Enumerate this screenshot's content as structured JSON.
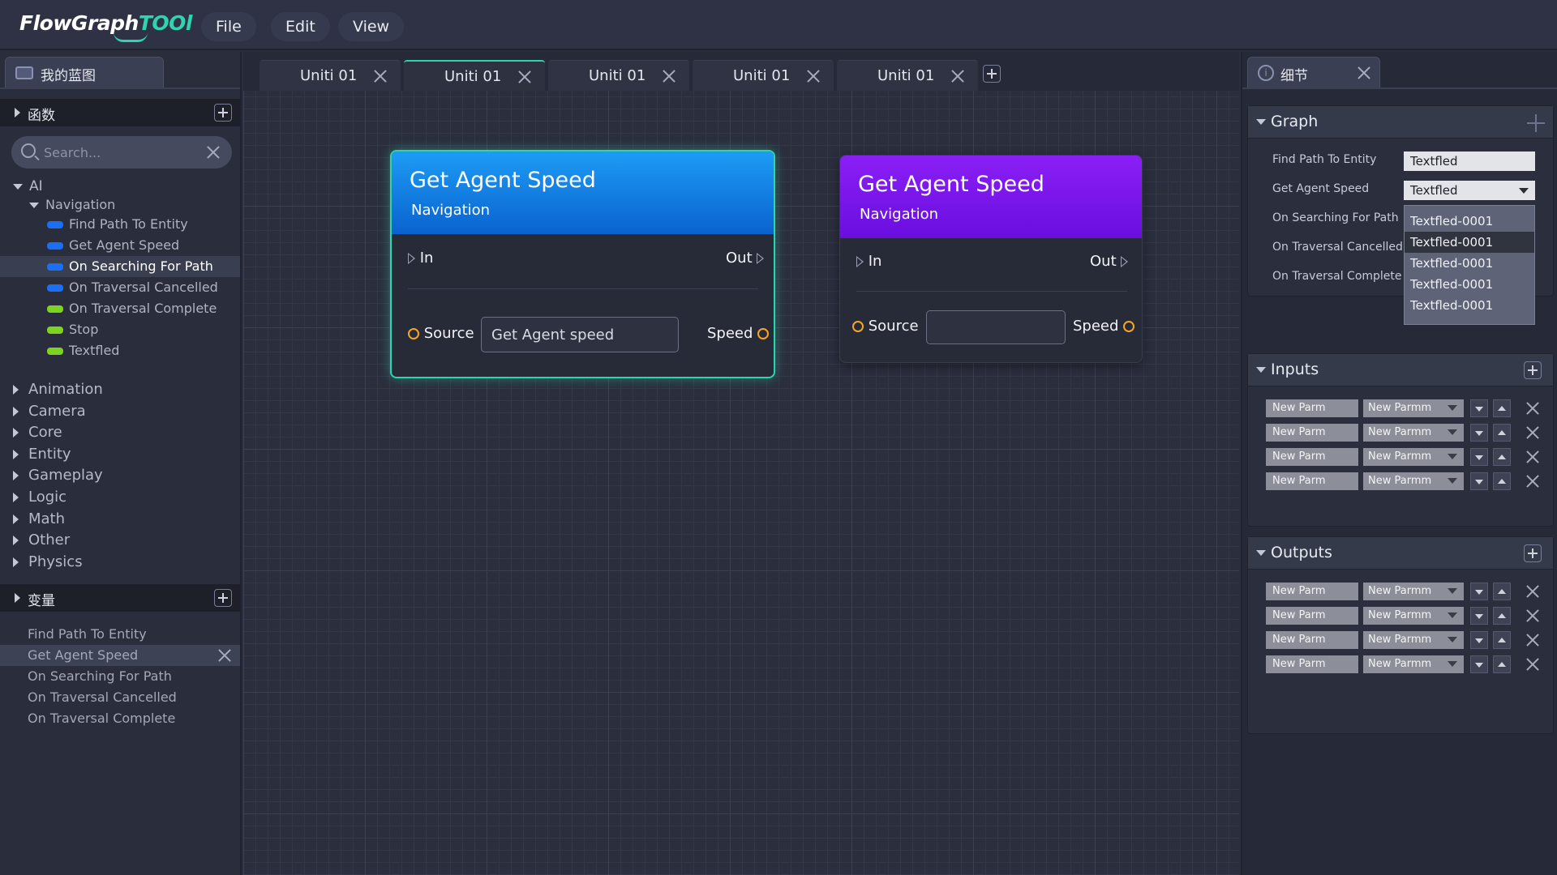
{
  "app": {
    "logo_main": "FlowGraph",
    "logo_accent": "TOOl"
  },
  "menu": {
    "file": "File",
    "edit": "Edit",
    "view": "View"
  },
  "left": {
    "tab_label": "我的蓝图",
    "functions_label": "函数",
    "search_placeholder": "Search...",
    "ai_label": "AI",
    "navigation_label": "Navigation",
    "nav_items": [
      {
        "label": "Find Path To Entity",
        "color": "blue"
      },
      {
        "label": "Get Agent Speed",
        "color": "blue"
      },
      {
        "label": "On Searching For Path",
        "color": "blue"
      },
      {
        "label": "On Traversal Cancelled",
        "color": "blue"
      },
      {
        "label": "On Traversal Complete",
        "color": "green"
      },
      {
        "label": "Stop",
        "color": "green"
      },
      {
        "label": "Textfled",
        "color": "green"
      }
    ],
    "categories": [
      "Animation",
      "Camera",
      "Core",
      "Entity",
      "Gameplay",
      "Logic",
      "Math",
      "Other",
      "Physics"
    ],
    "variables_label": "变量",
    "variables": [
      "Find Path To Entity",
      "Get Agent Speed",
      "On Searching For Path",
      "On Traversal Cancelled",
      "On Traversal Complete"
    ]
  },
  "tabs": [
    "Uniti 01",
    "Uniti 01",
    "Uniti 01",
    "Uniti 01",
    "Uniti 01"
  ],
  "nodes": [
    {
      "title": "Get Agent Speed",
      "subtitle": "Navigation",
      "in": "In",
      "out": "Out",
      "source": "Source",
      "source_value": "Get Agent speed",
      "speed": "Speed"
    },
    {
      "title": "Get Agent Speed",
      "subtitle": "Navigation",
      "in": "In",
      "out": "Out",
      "source": "Source",
      "source_value": "",
      "speed": "Speed"
    }
  ],
  "details": {
    "tab_label": "细节",
    "graph_label": "Graph",
    "props": [
      {
        "label": "Find Path To Entity",
        "value": "Textfled"
      },
      {
        "label": "Get Agent Speed",
        "value": "Textfled"
      },
      {
        "label": "On Searching For Path"
      },
      {
        "label": "On Traversal Cancelled"
      },
      {
        "label": "On Traversal Complete"
      }
    ],
    "dropdown_options": [
      "Textfled-0001",
      "Textfled-0001",
      "Textfled-0001",
      "Textfled-0001",
      "Textfled-0001"
    ],
    "inputs_label": "Inputs",
    "outputs_label": "Outputs",
    "inputs": [
      {
        "name": "New Parm",
        "type": "New Parmm"
      },
      {
        "name": "New Parm",
        "type": "New Parmm"
      },
      {
        "name": "New Parm",
        "type": "New Parmm"
      },
      {
        "name": "New Parm",
        "type": "New Parmm"
      }
    ],
    "outputs": [
      {
        "name": "New Parm",
        "type": "New Parmm"
      },
      {
        "name": "New Parm",
        "type": "New Parmm"
      },
      {
        "name": "New Parm",
        "type": "New Parmm"
      },
      {
        "name": "New Parm",
        "type": "New Parmm"
      }
    ]
  },
  "colors": {
    "accent": "#2ed3b0",
    "node_blue": "#0a62cf",
    "node_purple": "#6a0ee0",
    "pin": "#f5a623"
  }
}
